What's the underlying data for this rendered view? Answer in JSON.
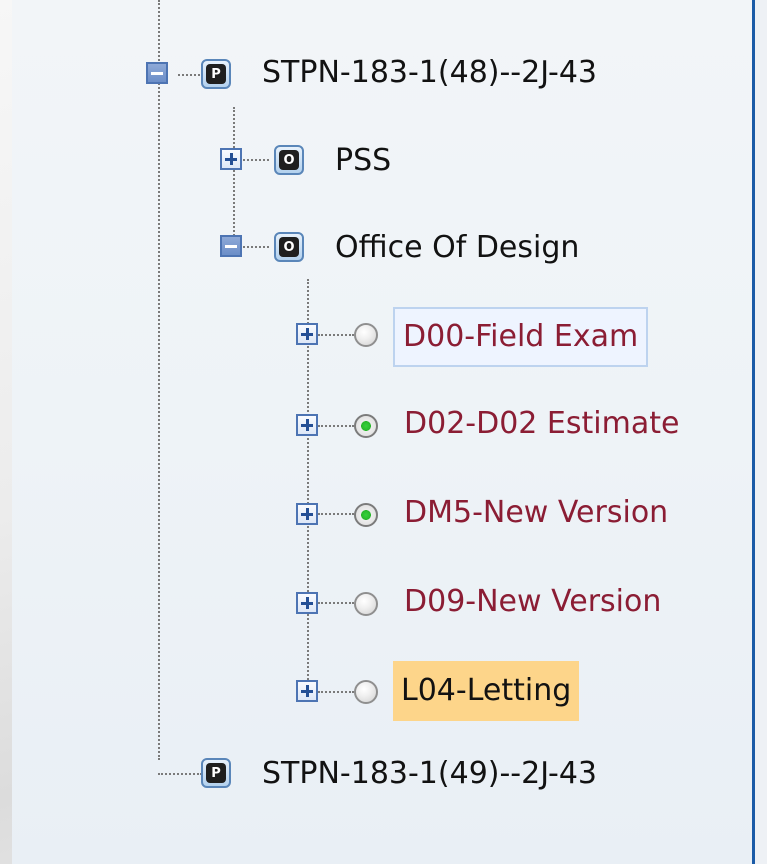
{
  "tree": {
    "root1": {
      "icon_letter": "P",
      "label": "STPN-183-1(48)--2J-43",
      "expanded": true
    },
    "children": [
      {
        "icon_letter": "O",
        "label": "PSS",
        "expanded": false
      },
      {
        "icon_letter": "O",
        "label": "Office Of Design",
        "expanded": true,
        "tasks": [
          {
            "label": "D00-Field Exam",
            "status": "gray",
            "state": "hover-selected"
          },
          {
            "label": "D02-D02 Estimate",
            "status": "green",
            "state": "normal"
          },
          {
            "label": "DM5-New Version",
            "status": "green",
            "state": "normal"
          },
          {
            "label": "D09-New Version",
            "status": "gray",
            "state": "normal"
          },
          {
            "label": "L04-Letting",
            "status": "gray",
            "state": "selected"
          }
        ]
      }
    ],
    "root2": {
      "icon_letter": "P",
      "label": "STPN-183-1(49)--2J-43"
    }
  },
  "colors": {
    "task_text": "#8b1d34",
    "selected_orange": "#fdd58a",
    "accent_border": "#1b5ba7"
  }
}
